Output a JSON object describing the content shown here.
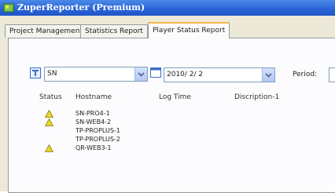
{
  "window": {
    "title": "ZuperReporter (Premium)"
  },
  "tabs": [
    {
      "label": "Project Management"
    },
    {
      "label": "Statistics Report"
    },
    {
      "label": "Player Status Report"
    }
  ],
  "filters": {
    "group_value": "SN",
    "date_value": "2010/ 2/ 2",
    "period_label": "Period:"
  },
  "table": {
    "columns": [
      "Status",
      "Hostname",
      "Log Time",
      "Discription-1"
    ],
    "rows": [
      {
        "status": "warning",
        "hostname": "SN-PRO4-1",
        "log_time": "",
        "description": ""
      },
      {
        "status": "warning",
        "hostname": "SN-WEB4-2",
        "log_time": "",
        "description": ""
      },
      {
        "status": "",
        "hostname": "TP-PROPLUS-1",
        "log_time": "",
        "description": ""
      },
      {
        "status": "",
        "hostname": "TP-PROPLUS-2",
        "log_time": "",
        "description": ""
      },
      {
        "status": "warning",
        "hostname": "QR-WEB3-1",
        "log_time": "",
        "description": ""
      }
    ]
  },
  "colors": {
    "titlebar": "#2a62d6",
    "active_tab_accent": "#f7b44a",
    "warning": "#e8d82a"
  },
  "icons": {
    "app": "app-logo-icon",
    "group": "group-icon",
    "calendar": "calendar-icon",
    "status": "warning-triangle-icon"
  }
}
